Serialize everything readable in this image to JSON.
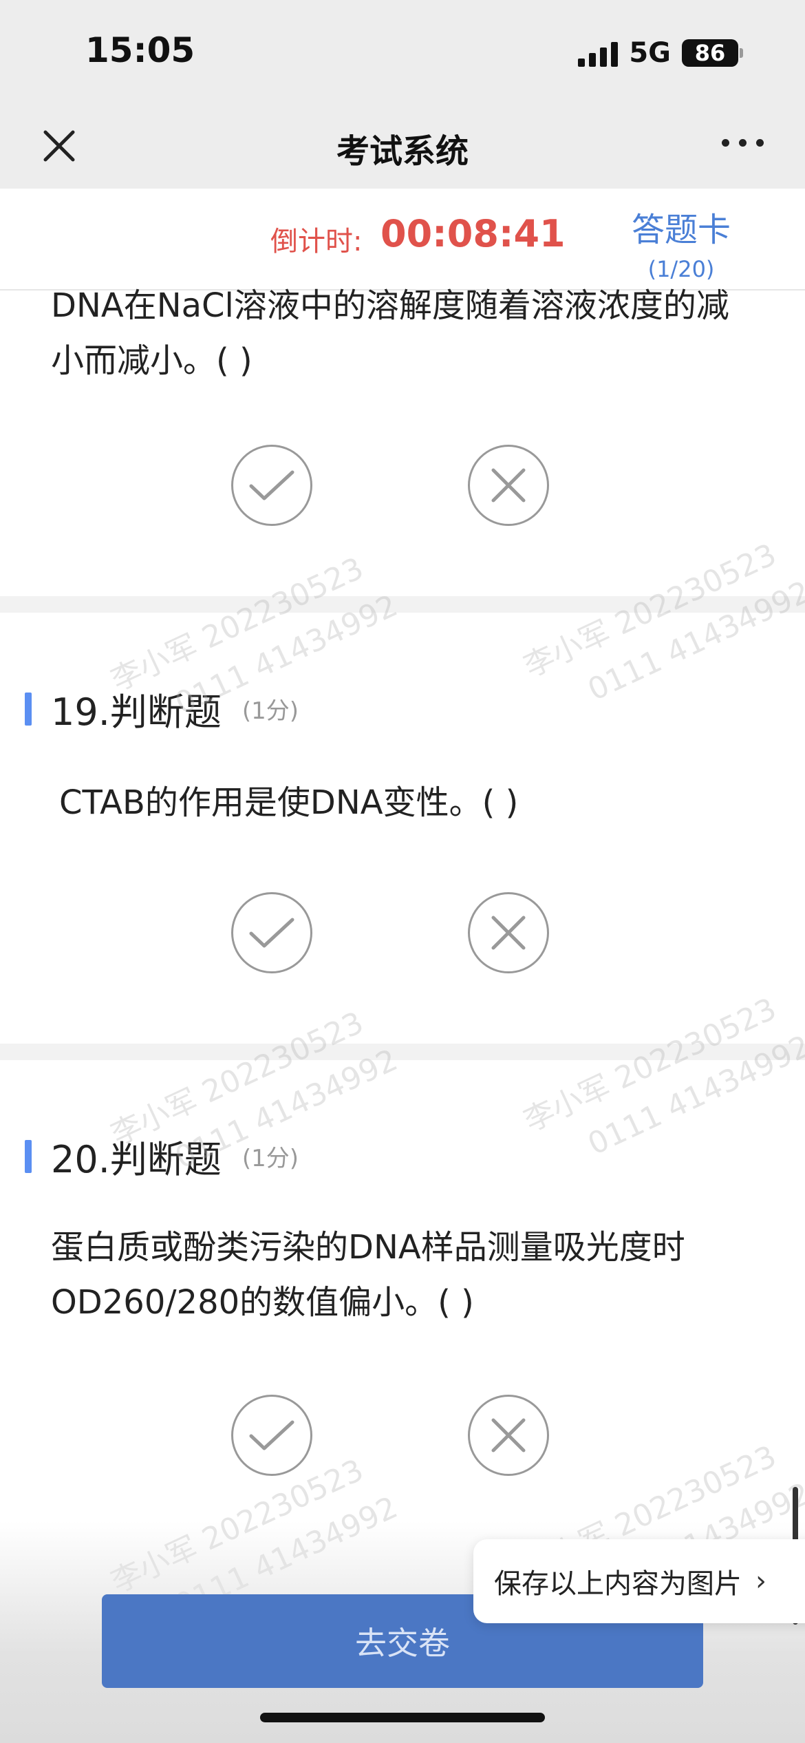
{
  "status_bar": {
    "time": "15:05",
    "network": "5G",
    "battery": "86"
  },
  "nav": {
    "title": "考试系统"
  },
  "timer": {
    "label": "倒计时:",
    "value": "00:08:41"
  },
  "answer_card": {
    "label": "答题卡",
    "count": "(1/20)"
  },
  "questions": [
    {
      "number": "",
      "score": "",
      "text": "DNA在NaCl溶液中的溶解度随着溶液浓度的减小而减小。(    )"
    },
    {
      "number": "19.判断题",
      "score": "(1分)",
      "text": "CTAB的作用是使DNA变性。(    )"
    },
    {
      "number": "20.判断题",
      "score": "(1分)",
      "text": "蛋白质或酚类污染的DNA样品测量吸光度时OD260/280的数值偏小。(    )"
    }
  ],
  "watermark": {
    "name": "李小军 202230523",
    "id": "0111 41434992"
  },
  "save_popup": {
    "label": "保存以上内容为图片"
  },
  "submit": {
    "label": "去交卷"
  }
}
